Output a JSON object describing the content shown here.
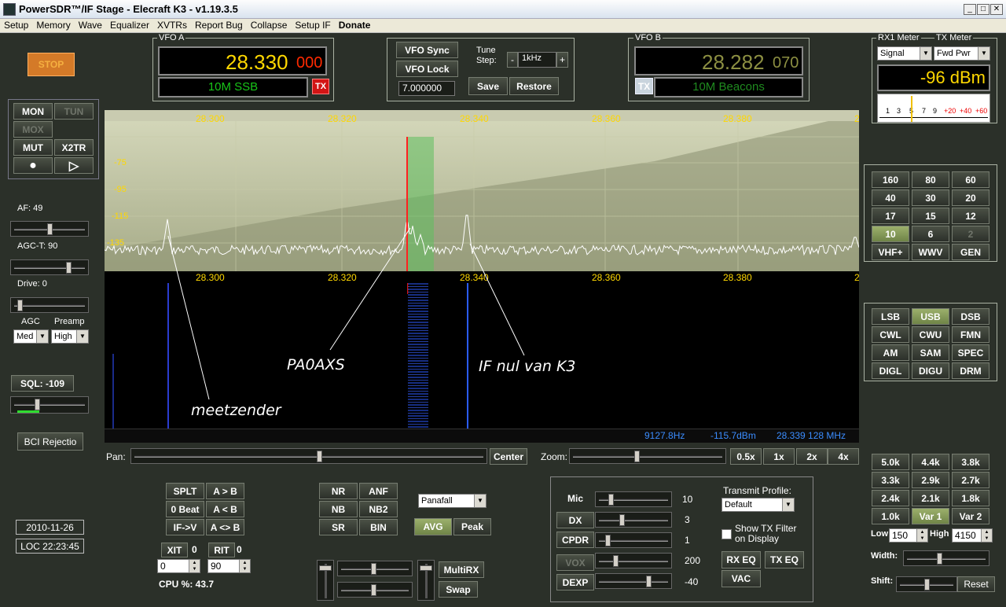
{
  "window": {
    "title": "PowerSDR™/IF Stage - Elecraft K3 - v1.19.3.5",
    "minimize": "_",
    "maximize": "□",
    "close": "✕"
  },
  "menu": [
    "Setup",
    "Memory",
    "Wave",
    "Equalizer",
    "XVTRs",
    "Report Bug",
    "Collapse",
    "Setup IF",
    "Donate"
  ],
  "left": {
    "stop": "STOP",
    "mon": "MON",
    "tun": "TUN",
    "mox": "MOX",
    "mut": "MUT",
    "x2tr": "X2TR",
    "rec": "●",
    "play": "▷",
    "af": "AF:  49",
    "agct": "AGC-T:  90",
    "drive": "Drive:  0",
    "agc_label": "AGC",
    "preamp_label": "Preamp",
    "agc_value": "Med",
    "preamp_value": "High",
    "sql": "SQL: -109",
    "bci": "BCI Rejectio",
    "date": "2010-11-26",
    "time": "LOC 22:23:45"
  },
  "vfoa": {
    "label": "VFO A",
    "freq_main": "28.330",
    "freq_sub": "000",
    "band": "10M SSB",
    "tx": "TX"
  },
  "center": {
    "vfo_sync": "VFO Sync",
    "vfo_lock": "VFO Lock",
    "tune_step_label": "Tune Step:",
    "tune_minus": "-",
    "tune_plus": "+",
    "tune_step": "1kHz",
    "freq_input": "7.000000",
    "save": "Save",
    "restore": "Restore"
  },
  "vfob": {
    "label": "VFO B",
    "freq_main": "28.282",
    "freq_sub": "070",
    "band": "10M Beacons",
    "tx": "TX"
  },
  "meter": {
    "rx_label": "RX1 Meter",
    "tx_label": "TX Meter",
    "rx_value": "Signal",
    "tx_value": "Fwd Pwr",
    "reading": "-96 dBm",
    "scale": [
      "1",
      "3",
      "5",
      "7",
      "9",
      "+20",
      "+40",
      "+60"
    ]
  },
  "display": {
    "freq_ticks": [
      "28.300",
      "28.320",
      "28.340",
      "28.360",
      "28.380",
      "2"
    ],
    "db_ticks": [
      "-75",
      "-95",
      "-115",
      "-135"
    ],
    "status_freq": "9127.8Hz",
    "status_dbm": "-115.7dBm",
    "status_mhz": "28.339 128 MHz",
    "annotations": {
      "meetzender": "meetzender",
      "pa0axs": "PA0AXS",
      "ifnul": "IF nul van K3"
    }
  },
  "bands": [
    "160",
    "80",
    "60",
    "40",
    "30",
    "20",
    "17",
    "15",
    "12",
    "10",
    "6",
    "2",
    "VHF+",
    "WWV",
    "GEN"
  ],
  "modes": [
    "LSB",
    "USB",
    "DSB",
    "CWL",
    "CWU",
    "FMN",
    "AM",
    "SAM",
    "SPEC",
    "DIGL",
    "DIGU",
    "DRM"
  ],
  "filters": [
    "5.0k",
    "4.4k",
    "3.8k",
    "3.3k",
    "2.9k",
    "2.7k",
    "2.4k",
    "2.1k",
    "1.8k",
    "1.0k",
    "Var 1",
    "Var 2"
  ],
  "filter_ctl": {
    "low_label": "Low",
    "low": "150",
    "high_label": "High",
    "high": "4150",
    "width_label": "Width:",
    "shift_label": "Shift:",
    "reset": "Reset"
  },
  "pan": {
    "pan_label": "Pan:",
    "center": "Center",
    "zoom_label": "Zoom:",
    "z05": "0.5x",
    "z1": "1x",
    "z2": "2x",
    "z4": "4x"
  },
  "split": {
    "splt": "SPLT",
    "atob": "A > B",
    "zerobeat": "0 Beat",
    "btoa": "A < B",
    "ifv": "IF->V",
    "swap": "A <> B",
    "xit": "XIT",
    "xit_val": "0",
    "rit": "RIT",
    "rit_val": "0",
    "xit_spin": "0",
    "rit_spin": "90",
    "cpu": "CPU %: 43.7"
  },
  "dsp": {
    "nr": "NR",
    "anf": "ANF",
    "nb": "NB",
    "nb2": "NB2",
    "sr": "SR",
    "bin": "BIN",
    "display_mode": "Panafall",
    "avg": "AVG",
    "peak": "Peak",
    "multirx": "MultiRX",
    "swap": "Swap"
  },
  "tx": {
    "mic": "Mic",
    "mic_val": "10",
    "dx": "DX",
    "dx_val": "3",
    "cpdr": "CPDR",
    "cpdr_val": "1",
    "vox": "VOX",
    "vox_val": "200",
    "dexp": "DEXP",
    "dexp_val": "-40",
    "profile_label": "Transmit Profile:",
    "profile": "Default",
    "show_filter": "Show TX Filter on Display",
    "rxeq": "RX EQ",
    "txeq": "TX EQ",
    "vac": "VAC"
  },
  "colors": {
    "vfo_a_freq": "#ffd800",
    "vfo_sub": "#ff2a00",
    "band_text": "#19c519",
    "vfo_b_freq": "#8c8f42",
    "status_text": "#3b8dff"
  }
}
